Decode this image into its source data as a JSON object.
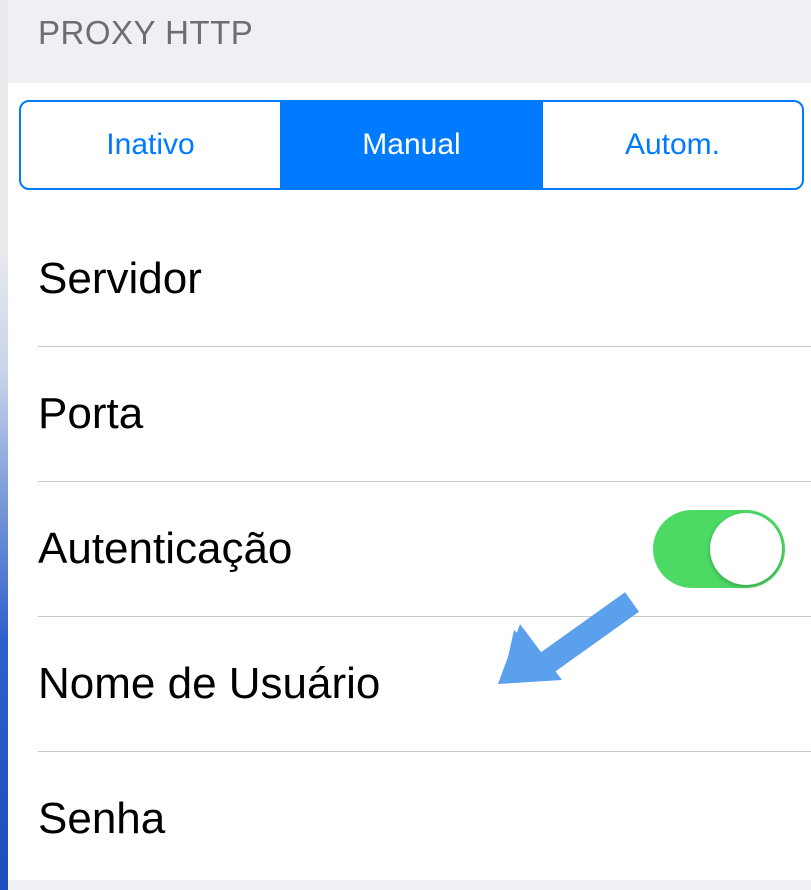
{
  "section": {
    "header": "PROXY HTTP"
  },
  "segmented_control": {
    "options": [
      "Inativo",
      "Manual",
      "Autom."
    ],
    "selected": "Manual"
  },
  "rows": [
    {
      "label": "Servidor"
    },
    {
      "label": "Porta"
    },
    {
      "label": "Autenticação",
      "toggle_on": true
    },
    {
      "label": "Nome de Usuário"
    },
    {
      "label": "Senha"
    }
  ],
  "colors": {
    "accent": "#007aff",
    "toggle_on": "#4cd964",
    "annotation_arrow": "#5aa0ec",
    "section_background": "#efeff4",
    "separator": "#c8c7cc"
  },
  "annotation": {
    "icon": "arrow-pointer-icon",
    "points_to": "Nome de Usuário"
  }
}
